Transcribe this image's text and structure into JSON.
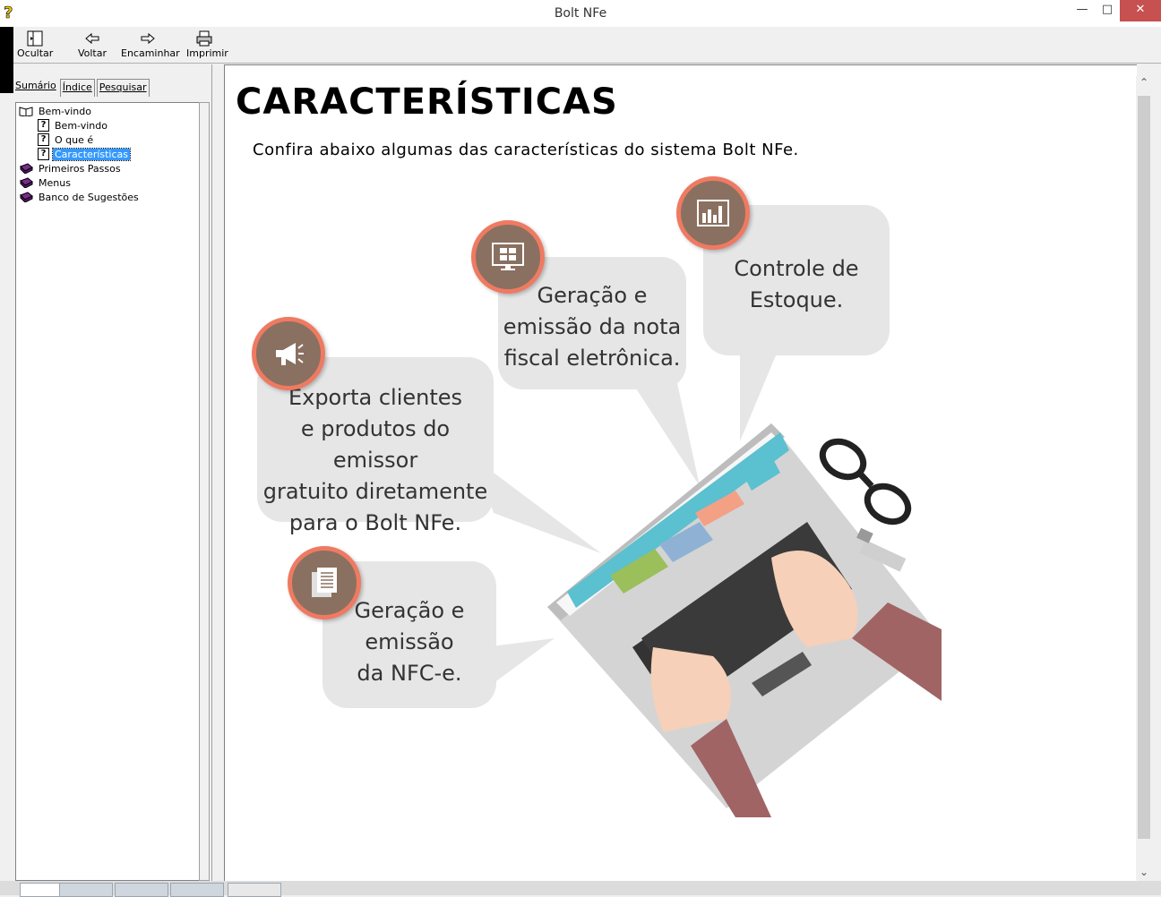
{
  "window": {
    "title": "Bolt NFe"
  },
  "toolbar": {
    "hide": "Ocultar",
    "back": "Voltar",
    "forward": "Encaminhar",
    "print": "Imprimir"
  },
  "tabs": [
    {
      "label": "Sumário"
    },
    {
      "label": "Índice"
    },
    {
      "label": "Pesquisar"
    }
  ],
  "tree": {
    "items": [
      {
        "label": "Bem-vindo",
        "type": "open-book"
      },
      {
        "label": "Bem-vindo",
        "type": "page"
      },
      {
        "label": "O que é",
        "type": "page"
      },
      {
        "label": "Características",
        "type": "page",
        "selected": true
      },
      {
        "label": "Primeiros Passos",
        "type": "book"
      },
      {
        "label": "Menus",
        "type": "book"
      },
      {
        "label": "Banco de Sugestões",
        "type": "book"
      }
    ]
  },
  "page": {
    "title": "CARACTERÍSTICAS",
    "subtitle": "Confira abaixo algumas das características do sistema Bolt NFe."
  },
  "features": {
    "stock": [
      "Controle de",
      "Estoque."
    ],
    "nfe": [
      "Geração e",
      "emissão da nota",
      "fiscal eletrônica."
    ],
    "export": [
      "Exporta clientes",
      "e produtos do emissor",
      "gratuito diretamente",
      "para o Bolt NFe."
    ],
    "nfce": [
      "Geração e",
      "emissão",
      "da NFC-e."
    ]
  },
  "colors": {
    "badge_ring": "#ef7a62",
    "badge_fill": "#8a7060",
    "bubble": "#e6e6e6",
    "selection": "#3399ff"
  }
}
